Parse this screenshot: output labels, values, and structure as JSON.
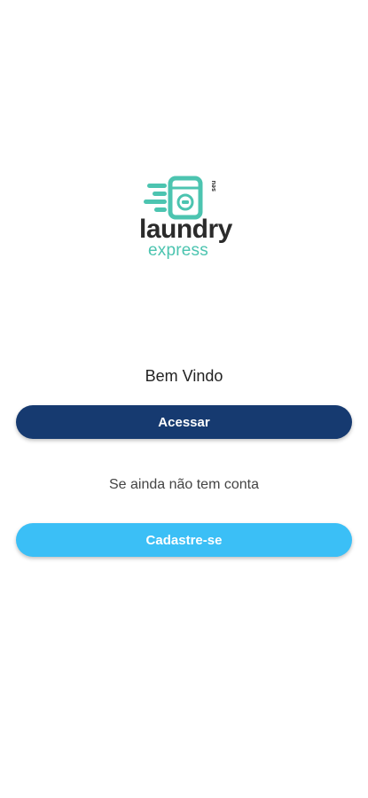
{
  "logo": {
    "icon": "washing-machine-icon",
    "tag": "seu",
    "word_primary": "laundry",
    "word_secondary": "express",
    "colors": {
      "accent": "#4cc4b0",
      "dark": "#2b2b2b"
    }
  },
  "welcome": {
    "title": "Bem Vindo"
  },
  "buttons": {
    "access_label": "Acessar",
    "signup_label": "Cadastre-se"
  },
  "signup_hint": "Se ainda não tem conta",
  "colors": {
    "primary": "#163a70",
    "secondary": "#3bbff6",
    "background": "#ffffff"
  }
}
